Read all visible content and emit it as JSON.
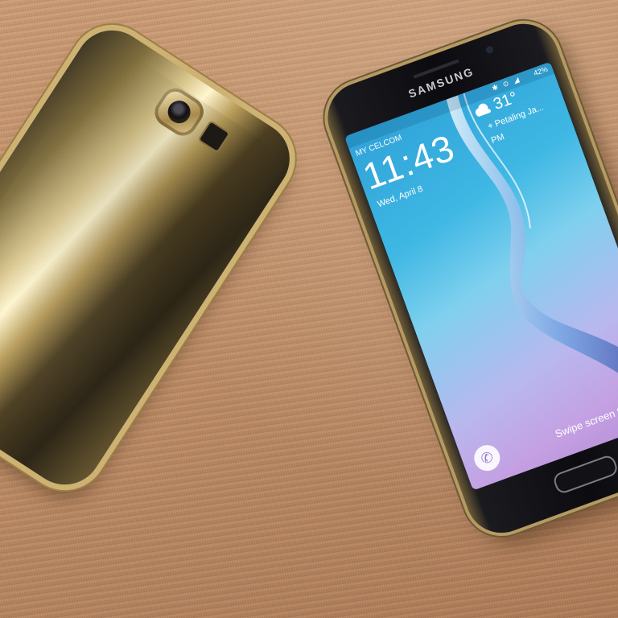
{
  "front_phone": {
    "brand": "SAMSUNG",
    "status_bar": {
      "carrier": "MY CELCOM",
      "battery": "42%",
      "icons": "✱ ⊙ ◢"
    },
    "lock_screen": {
      "time": "11:43",
      "ampm": "PM",
      "date": "Wed, April 8",
      "temperature": "31°",
      "location": "Petaling Ja...",
      "unlock_hint": "Swipe screen to unlock",
      "phone_glyph": "✆"
    }
  },
  "colors": {
    "table": "#c3916a",
    "gold_frame": "#cdb273",
    "screen_top": "#2fa2d8",
    "screen_bottom": "#c4a0e2"
  },
  "icons": [
    "weather-cloud-icon",
    "phone-icon",
    "location-pin-icon",
    "camera-lens-icon",
    "flash-icon"
  ]
}
